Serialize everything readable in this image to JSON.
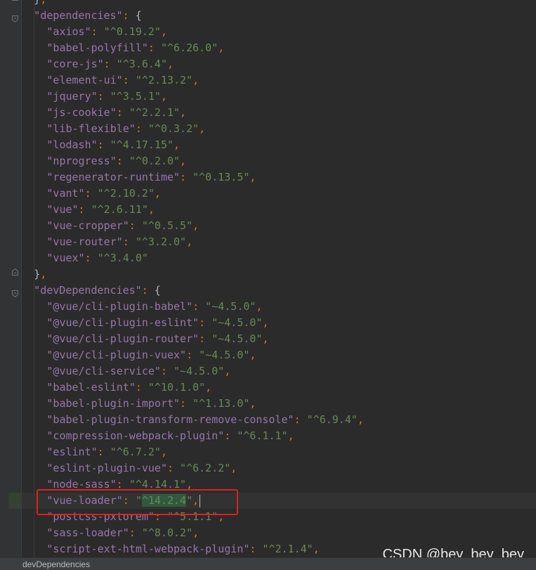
{
  "editor": {
    "lines": [
      {
        "indent": 2,
        "key": "",
        "value": "",
        "prefix": "",
        "suffix": "},"
      },
      {
        "indent": 2,
        "key": "\"dependencies\"",
        "value": "",
        "prefix": "",
        "suffix": ": {"
      },
      {
        "indent": 4,
        "key": "\"axios\"",
        "value": "\"^0.19.2\"",
        "suffix": ","
      },
      {
        "indent": 4,
        "key": "\"babel-polyfill\"",
        "value": "\"^6.26.0\"",
        "suffix": ","
      },
      {
        "indent": 4,
        "key": "\"core-js\"",
        "value": "\"^3.6.4\"",
        "suffix": ","
      },
      {
        "indent": 4,
        "key": "\"element-ui\"",
        "value": "\"^2.13.2\"",
        "suffix": ","
      },
      {
        "indent": 4,
        "key": "\"jquery\"",
        "value": "\"^3.5.1\"",
        "suffix": ","
      },
      {
        "indent": 4,
        "key": "\"js-cookie\"",
        "value": "\"^2.2.1\"",
        "suffix": ","
      },
      {
        "indent": 4,
        "key": "\"lib-flexible\"",
        "value": "\"^0.3.2\"",
        "suffix": ","
      },
      {
        "indent": 4,
        "key": "\"lodash\"",
        "value": "\"^4.17.15\"",
        "suffix": ","
      },
      {
        "indent": 4,
        "key": "\"nprogress\"",
        "value": "\"^0.2.0\"",
        "suffix": ","
      },
      {
        "indent": 4,
        "key": "\"regenerator-runtime\"",
        "value": "\"^0.13.5\"",
        "suffix": ","
      },
      {
        "indent": 4,
        "key": "\"vant\"",
        "value": "\"^2.10.2\"",
        "suffix": ","
      },
      {
        "indent": 4,
        "key": "\"vue\"",
        "value": "\"^2.6.11\"",
        "suffix": ","
      },
      {
        "indent": 4,
        "key": "\"vue-cropper\"",
        "value": "\"^0.5.5\"",
        "suffix": ","
      },
      {
        "indent": 4,
        "key": "\"vue-router\"",
        "value": "\"^3.2.0\"",
        "suffix": ","
      },
      {
        "indent": 4,
        "key": "\"vuex\"",
        "value": "\"^3.4.0\"",
        "suffix": ""
      },
      {
        "indent": 2,
        "key": "",
        "value": "",
        "suffix": "},"
      },
      {
        "indent": 2,
        "key": "\"devDependencies\"",
        "value": "",
        "suffix": ": {"
      },
      {
        "indent": 4,
        "key": "\"@vue/cli-plugin-babel\"",
        "value": "\"~4.5.0\"",
        "suffix": ","
      },
      {
        "indent": 4,
        "key": "\"@vue/cli-plugin-eslint\"",
        "value": "\"~4.5.0\"",
        "suffix": ","
      },
      {
        "indent": 4,
        "key": "\"@vue/cli-plugin-router\"",
        "value": "\"~4.5.0\"",
        "suffix": ","
      },
      {
        "indent": 4,
        "key": "\"@vue/cli-plugin-vuex\"",
        "value": "\"~4.5.0\"",
        "suffix": ","
      },
      {
        "indent": 4,
        "key": "\"@vue/cli-service\"",
        "value": "\"~4.5.0\"",
        "suffix": ","
      },
      {
        "indent": 4,
        "key": "\"babel-eslint\"",
        "value": "\"^10.1.0\"",
        "suffix": ","
      },
      {
        "indent": 4,
        "key": "\"babel-plugin-import\"",
        "value": "\"^1.13.0\"",
        "suffix": ","
      },
      {
        "indent": 4,
        "key": "\"babel-plugin-transform-remove-console\"",
        "value": "\"^6.9.4\"",
        "suffix": ","
      },
      {
        "indent": 4,
        "key": "\"compression-webpack-plugin\"",
        "value": "\"^6.1.1\"",
        "suffix": ","
      },
      {
        "indent": 4,
        "key": "\"eslint\"",
        "value": "\"^6.7.2\"",
        "suffix": ","
      },
      {
        "indent": 4,
        "key": "\"eslint-plugin-vue\"",
        "value": "\"^6.2.2\"",
        "suffix": ","
      },
      {
        "indent": 4,
        "key": "\"node-sass\"",
        "value": "\"^4.14.1\"",
        "suffix": ","
      },
      {
        "indent": 4,
        "key": "\"vue-loader\"",
        "value": "\"^14.2.4\"",
        "suffix": ",",
        "current": true
      },
      {
        "indent": 4,
        "key": "\"postcss-pxtorem\"",
        "value": "\"^5.1.1\"",
        "suffix": ","
      },
      {
        "indent": 4,
        "key": "\"sass-loader\"",
        "value": "\"^8.0.2\"",
        "suffix": ","
      },
      {
        "indent": 4,
        "key": "\"script-ext-html-webpack-plugin\"",
        "value": "\"^2.1.4\"",
        "suffix": ","
      }
    ]
  },
  "statusbar": {
    "breadcrumb": "devDependencies"
  },
  "watermark": {
    "text": "CSDN @bey_bey_bey"
  },
  "colors": {
    "background": "#2b2b2b",
    "key": "#9876aa",
    "string": "#6a8759",
    "punctuation": "#cc7832",
    "highlight_box": "#e02020"
  }
}
